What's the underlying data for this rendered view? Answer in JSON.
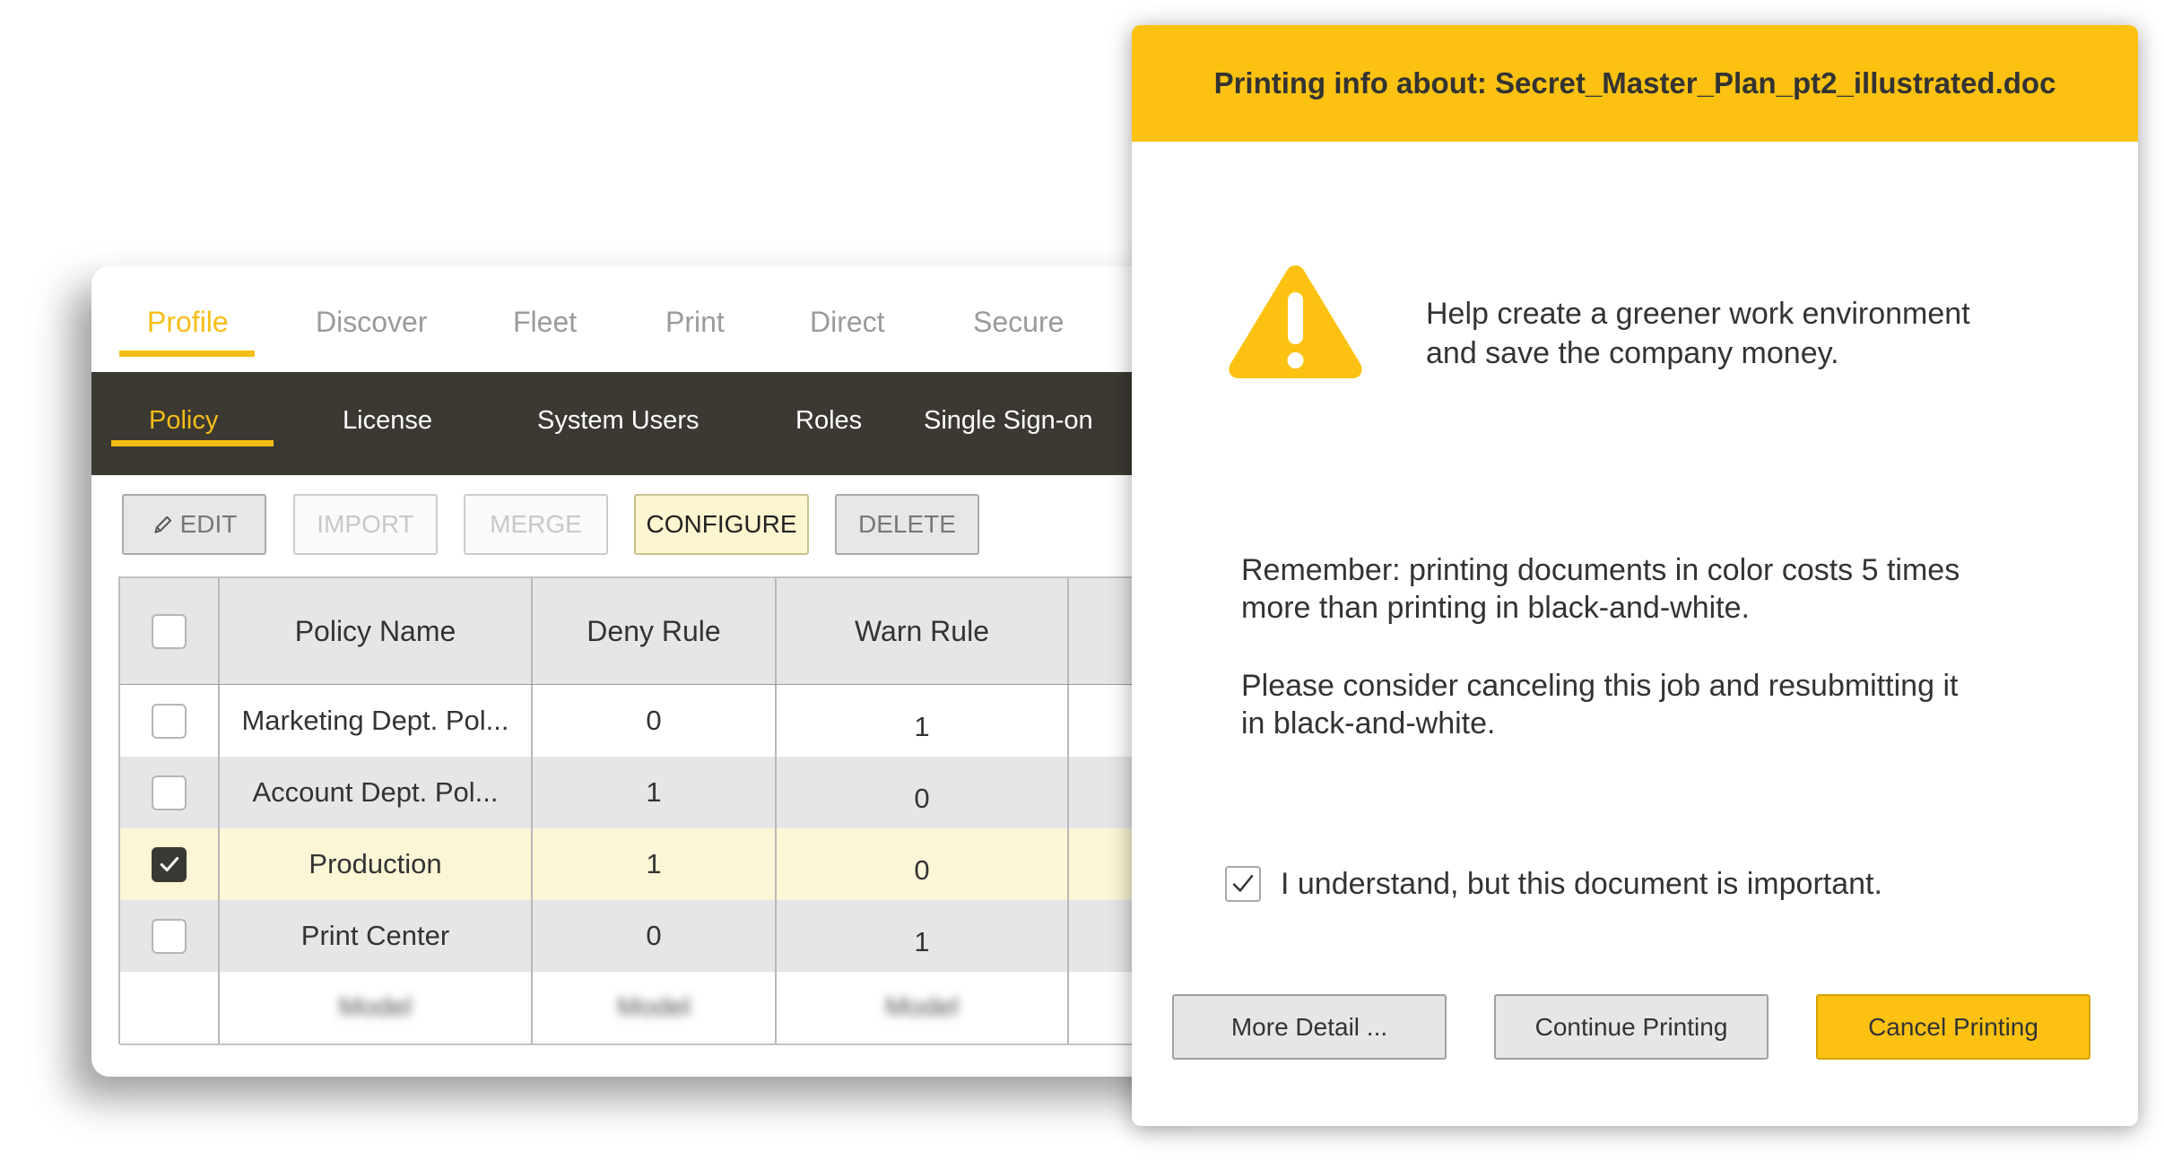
{
  "top_tabs": [
    "Profile",
    "Discover",
    "Fleet",
    "Print",
    "Direct",
    "Secure"
  ],
  "sub_tabs": [
    "Policy",
    "License",
    "System Users",
    "Roles",
    "Single Sign-on"
  ],
  "toolbar": {
    "edit_label": "EDIT",
    "import_label": "IMPORT",
    "merge_label": "MERGE",
    "configure_label": "CONFIGURE",
    "delete_label": "DELETE"
  },
  "table": {
    "headers": [
      "Policy Name",
      "Deny Rule",
      "Warn Rule"
    ],
    "rows": [
      {
        "name": "Marketing Dept. Pol...",
        "deny": "0",
        "warn": "1",
        "checked": false
      },
      {
        "name": "Account Dept. Pol...",
        "deny": "1",
        "warn": "0",
        "checked": false
      },
      {
        "name": "Production",
        "deny": "1",
        "warn": "0",
        "checked": true
      },
      {
        "name": "Print Center",
        "deny": "0",
        "warn": "1",
        "checked": false
      }
    ],
    "blurred_row": [
      "Model",
      "Model",
      "Model"
    ]
  },
  "colors": {
    "accent_yellow": "#fdc211",
    "nav_dark": "#3c3933",
    "selected_row": "#fbf6d5"
  },
  "dialog": {
    "title": "Printing info about: Secret_Master_Plan_pt2_illustrated.doc",
    "icon": "warning-icon",
    "message_line1": "Help create a greener work environment",
    "message_line2": "and save the company money.",
    "remember_line1": "Remember: printing documents in color costs 5 times",
    "remember_line2": "more than printing in black-and-white.",
    "consider_line1": "Please consider canceling this job and resubmitting it",
    "consider_line2": "in black-and-white.",
    "acknowledge_label": "I understand, but this document is important.",
    "acknowledge_checked": true,
    "buttons": {
      "more": "More Detail ...",
      "continue": "Continue Printing",
      "cancel": "Cancel Printing"
    }
  }
}
